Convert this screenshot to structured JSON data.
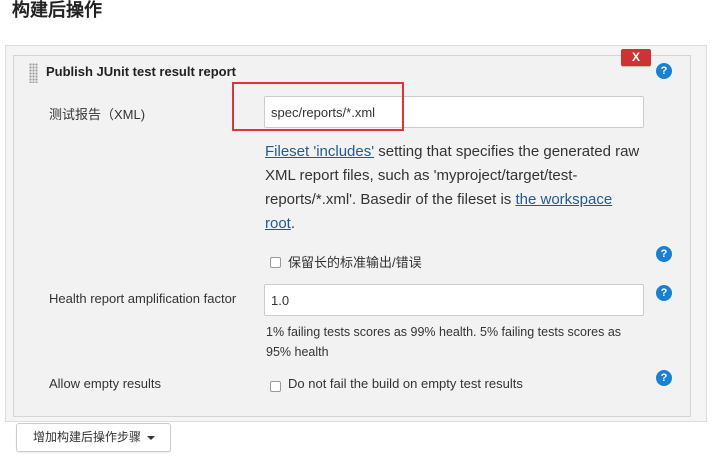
{
  "section": {
    "title": "构建后操作"
  },
  "publisher": {
    "title": "Publish JUnit test result report",
    "delete_label": "X",
    "help_icon": "?",
    "test_report_xml": {
      "label": "测试报告（XML)",
      "value": "spec/reports/*.xml",
      "help": {
        "link1": "Fileset 'includes'",
        "text1": " setting that specifies the generated raw XML report files, such as 'myproject/target/test-reports/*.xml'. Basedir of the fileset is ",
        "link2": "the workspace root",
        "text2": "."
      }
    },
    "keep_long_stdio": {
      "label": "保留长的标准输出/错误",
      "checked": false
    },
    "health_factor": {
      "label": "Health report amplification factor",
      "value": "1.0",
      "help": "1% failing tests scores as 99% health. 5% failing tests scores as 95% health"
    },
    "allow_empty": {
      "label": "Allow empty results",
      "checkbox_label": "Do not fail the build on empty test results",
      "checked": false
    }
  },
  "add_step_button": {
    "label": "增加构建后操作步骤"
  },
  "colors": {
    "delete": "#cc3333",
    "help": "#1a80d0",
    "link": "#235a94",
    "highlight": "#e0343a"
  }
}
